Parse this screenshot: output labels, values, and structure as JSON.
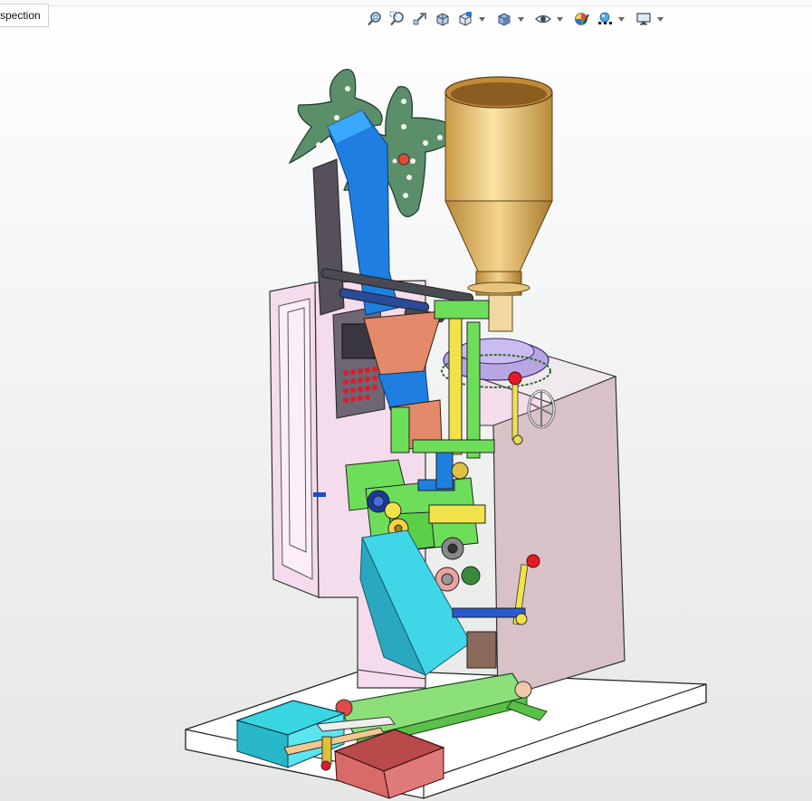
{
  "document_tab": {
    "label": "spection"
  },
  "view_toolbar": {
    "icons": [
      "zoom-to-fit-icon",
      "zoom-to-area-icon",
      "previous-view-icon",
      "section-view-icon",
      "view-orientation-icon",
      "display-style-icon",
      "hide-show-items-icon",
      "edit-appearance-icon",
      "apply-scene-icon",
      "view-settings-icon"
    ]
  },
  "colors": {
    "hopper": "#e7c27a",
    "frame_pink": "#f4dcec",
    "cabinet": "#d8c2c8",
    "chute_blue": "#1e7fe0",
    "film_roller": "#5b8f6a",
    "chute_cyan": "#3fd7e8",
    "accent_green": "#6dde5a",
    "conveyor_green": "#8ce07a",
    "yellow": "#f2e24a",
    "tray_red": "#e07a78",
    "tray_cyan": "#39d6e2"
  }
}
